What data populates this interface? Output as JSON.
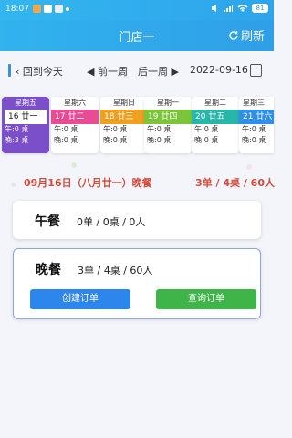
{
  "status_bar": {
    "time": "18:07",
    "battery": "81"
  },
  "header": {
    "title": "门店一",
    "refresh_icon": "refresh-icon",
    "refresh_label": "刷新"
  },
  "nav": {
    "back_today": "回到今天",
    "prev_week": "前一周",
    "next_week": "后一周",
    "date": "2022-09-16",
    "calendar_icon": "calendar-icon"
  },
  "days": [
    {
      "weekday": "星期五",
      "date": "16  廿一",
      "lunch": "午:0 桌",
      "dinner": "晚:3 桌",
      "color": "#7b4fc9",
      "selected": true
    },
    {
      "weekday": "星期六",
      "date": "17  廿二",
      "lunch": "午:0 桌",
      "dinner": "晚:0 桌",
      "color": "#e84c95"
    },
    {
      "weekday": "星期日",
      "date": "18  廿三",
      "lunch": "午:0 桌",
      "dinner": "晚:0 桌",
      "color": "#f0a020"
    },
    {
      "weekday": "星期一",
      "date": "19  廿四",
      "lunch": "午:0 桌",
      "dinner": "晚:0 桌",
      "color": "#7cc43a"
    },
    {
      "weekday": "星期二",
      "date": "20  廿五",
      "lunch": "午:0 桌",
      "dinner": "晚:0 桌",
      "color": "#27b6a7"
    },
    {
      "weekday": "星期三",
      "date": "21  廿六",
      "lunch": "午:0 桌",
      "dinner": "晚:0 桌",
      "color": "#2f8fe6"
    }
  ],
  "summary": {
    "date_meal": "09月16日（八月廿一）晚餐",
    "counts": "3单 / 4桌 / 60人"
  },
  "lunch_card": {
    "meal": "午餐",
    "stat": "0单 / 0桌 / 0人"
  },
  "dinner_card": {
    "meal": "晚餐",
    "stat": "3单 / 4桌 / 60人",
    "create_button": "创建订单",
    "query_button": "查询订单"
  },
  "colors": {
    "header": "#2fa9ec",
    "summary_text": "#d34b3c",
    "create_button": "#2d86ec",
    "query_button": "#3fb449"
  }
}
